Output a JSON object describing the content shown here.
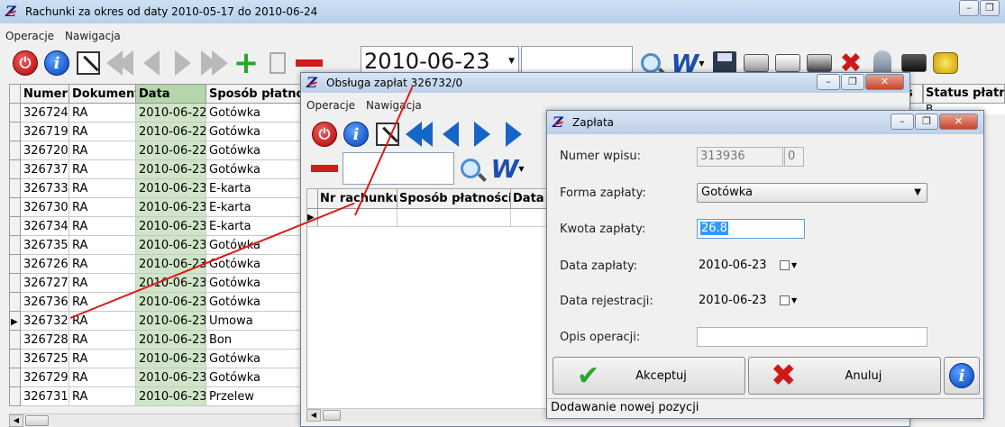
{
  "main_window": {
    "title": "Rachunki za okres od daty 2010-05-17 do 2010-06-24",
    "menu": [
      "Operacje",
      "Nawigacja"
    ],
    "date_combo": "2010-06-23",
    "columns": [
      "Numer",
      "Dokument",
      "Data",
      "Sposób płatno",
      "Status płatno"
    ],
    "rows": [
      {
        "numer": "326724",
        "dokument": "RA",
        "data": "2010-06-22",
        "sposob": "Gotówka"
      },
      {
        "numer": "326719",
        "dokument": "RA",
        "data": "2010-06-22",
        "sposob": "Gotówka"
      },
      {
        "numer": "326720",
        "dokument": "RA",
        "data": "2010-06-22",
        "sposob": "Gotówka"
      },
      {
        "numer": "326737",
        "dokument": "RA",
        "data": "2010-06-23",
        "sposob": "Gotówka"
      },
      {
        "numer": "326733",
        "dokument": "RA",
        "data": "2010-06-23",
        "sposob": "E-karta"
      },
      {
        "numer": "326730",
        "dokument": "RA",
        "data": "2010-06-23",
        "sposob": "E-karta"
      },
      {
        "numer": "326734",
        "dokument": "RA",
        "data": "2010-06-23",
        "sposob": "E-karta"
      },
      {
        "numer": "326735",
        "dokument": "RA",
        "data": "2010-06-23",
        "sposob": "Gotówka"
      },
      {
        "numer": "326726",
        "dokument": "RA",
        "data": "2010-06-23",
        "sposob": "Gotówka"
      },
      {
        "numer": "326727",
        "dokument": "RA",
        "data": "2010-06-23",
        "sposob": "Gotówka"
      },
      {
        "numer": "326736",
        "dokument": "RA",
        "data": "2010-06-23",
        "sposob": "Gotówka"
      },
      {
        "numer": "326732",
        "dokument": "RA",
        "data": "2010-06-23",
        "sposob": "Umowa",
        "current": true
      },
      {
        "numer": "326728",
        "dokument": "RA",
        "data": "2010-06-23",
        "sposob": "Bon"
      },
      {
        "numer": "326725",
        "dokument": "RA",
        "data": "2010-06-23",
        "sposob": "Gotówka"
      },
      {
        "numer": "326729",
        "dokument": "RA",
        "data": "2010-06-23",
        "sposob": "Gotówka"
      },
      {
        "numer": "326731",
        "dokument": "RA",
        "data": "2010-06-23",
        "sposob": "Przelew"
      }
    ],
    "status_cell": "B"
  },
  "payments_window": {
    "title": "Obsługa zapłat 326732/0",
    "menu": [
      "Operacje",
      "Nawigacja"
    ],
    "columns": [
      "Nr rachunku",
      "Sposób płatności",
      "Data"
    ]
  },
  "payment_dialog": {
    "title": "Zapłata",
    "numer_wpisu_label": "Numer wpisu:",
    "numer_wpisu_value": "313936",
    "numer_wpisu_suffix": "0",
    "forma_label": "Forma zapłaty:",
    "forma_value": "Gotówka",
    "kwota_label": "Kwota zapłaty:",
    "kwota_value": "26.8",
    "data_zaplaty_label": "Data zapłaty:",
    "data_zaplaty_value": "2010-06-23",
    "data_rejestracji_label": "Data rejestracji:",
    "data_rejestracji_value": "2010-06-23",
    "opis_label": "Opis operacji:",
    "opis_value": "",
    "accept_label": "Akceptuj",
    "cancel_label": "Anuluj",
    "status": "Dodawanie nowej pozycji"
  },
  "colors": {
    "date_column_highlight": "#cfe5c7",
    "annotation_line": "#e01818"
  }
}
